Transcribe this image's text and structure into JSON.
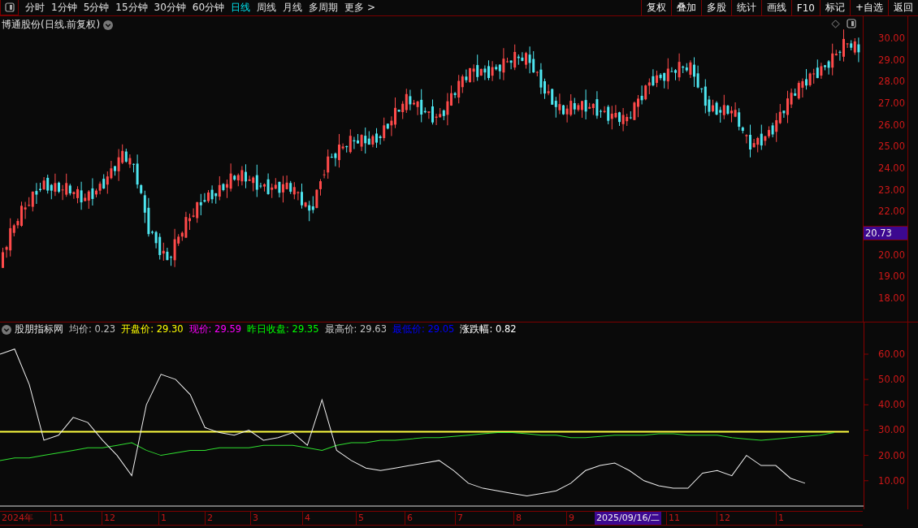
{
  "toolbar": {
    "periods": [
      {
        "label": "分时",
        "selected": false
      },
      {
        "label": "1分钟",
        "selected": false
      },
      {
        "label": "5分钟",
        "selected": false
      },
      {
        "label": "15分钟",
        "selected": false
      },
      {
        "label": "30分钟",
        "selected": false
      },
      {
        "label": "60分钟",
        "selected": false
      },
      {
        "label": "日线",
        "selected": true
      },
      {
        "label": "周线",
        "selected": false
      },
      {
        "label": "月线",
        "selected": false
      },
      {
        "label": "多周期",
        "selected": false
      },
      {
        "label": "更多 >",
        "selected": false
      }
    ],
    "buttons": [
      "复权",
      "叠加",
      "多股",
      "统计",
      "画线",
      "F10",
      "标记",
      "+自选",
      "返回"
    ]
  },
  "price_chart": {
    "title": "博通股份(日线.前复权)",
    "axis_labels": [
      "30.00",
      "29.00",
      "28.00",
      "27.00",
      "26.00",
      "25.00",
      "24.00",
      "23.00",
      "22.00",
      "20.00",
      "19.00",
      "18.00"
    ],
    "price_tag": "20.73"
  },
  "indicator": {
    "name": "股朋指标网",
    "readings": [
      {
        "label": "均价:",
        "value": "0.23",
        "color": "#c0c0c0"
      },
      {
        "label": "开盘价:",
        "value": "29.30",
        "color": "#ffff00"
      },
      {
        "label": "现价:",
        "value": "29.59",
        "color": "#ff00ff"
      },
      {
        "label": "昨日收盘:",
        "value": "29.35",
        "color": "#00ff00"
      },
      {
        "label": "最高价:",
        "value": "29.63",
        "color": "#c0c0c0"
      },
      {
        "label": "最低价:",
        "value": "29.05",
        "color": "#0000ff"
      },
      {
        "label": "涨跌幅:",
        "value": "0.82",
        "color": "#ffffff"
      }
    ],
    "chart_data": {
      "type": "line",
      "ylim": [
        -1.3,
        72.5
      ],
      "yticks": [
        {
          "value": 60,
          "label": "60.00"
        },
        {
          "value": 50,
          "label": "50.00"
        },
        {
          "value": 40,
          "label": "40.00"
        },
        {
          "value": 30,
          "label": "30.00"
        },
        {
          "value": 20,
          "label": "20.00"
        },
        {
          "value": 10,
          "label": "10.00"
        }
      ],
      "series": [
        {
          "color": "#ffff40",
          "values": [
            29.3,
            29.3,
            29.3,
            29.3,
            29.3,
            29.3,
            29.3,
            29.3,
            29.3,
            29.3,
            29.3,
            29.3,
            29.3,
            29.3,
            29.3,
            29.3,
            29.3,
            29.3,
            29.3,
            29.3,
            29.3,
            29.3,
            29.3,
            29.3,
            29.3,
            29.3,
            29.3,
            29.3,
            29.3,
            29.3,
            29.3,
            29.3,
            29.3,
            29.3,
            29.3,
            29.3,
            29.3,
            29.3,
            29.3,
            29.3,
            29.3,
            29.3,
            29.3,
            29.3,
            29.3,
            29.3,
            29.3,
            29.3,
            29.3,
            29.3,
            29.3,
            29.3,
            29.3,
            29.3,
            29.3,
            29.3,
            29.3,
            29.3,
            29.3
          ]
        },
        {
          "color": "#30e030",
          "values": [
            18,
            19,
            19,
            20,
            21,
            22,
            23,
            23,
            24,
            25,
            22,
            20,
            21,
            22,
            22,
            23,
            23,
            23,
            24,
            24,
            24,
            23,
            22,
            24,
            25,
            25,
            26,
            26,
            26.5,
            27,
            27,
            27.5,
            28,
            28.5,
            29,
            29,
            28.5,
            28,
            28,
            27,
            27,
            27.5,
            28,
            28,
            28,
            28.5,
            28.5,
            28,
            28,
            28,
            27,
            26.5,
            26,
            26.5,
            27,
            27.5,
            28,
            29,
            null
          ]
        },
        {
          "color": "#f0f0f0",
          "values": [
            60,
            62,
            48,
            26,
            28,
            35,
            33,
            26,
            20,
            12,
            40,
            52,
            50,
            44,
            31,
            29,
            28,
            30,
            26,
            27,
            29,
            24,
            42,
            22,
            18,
            15,
            14,
            15,
            16,
            17,
            18,
            14,
            9,
            7,
            6,
            5,
            4,
            5,
            6,
            9,
            14,
            16,
            17,
            14,
            10,
            8,
            7,
            7,
            13,
            14,
            12,
            20,
            16,
            16,
            11,
            9,
            null,
            null,
            null
          ]
        }
      ]
    }
  },
  "time_axis": {
    "labels": [
      "2024年",
      "11",
      "12",
      "1",
      "2",
      "3",
      "4",
      "5",
      "6",
      "7",
      "8",
      "9"
    ],
    "cursor_date": "2025/09/16/二",
    "labels_after": [
      "11",
      "12",
      "1"
    ]
  }
}
